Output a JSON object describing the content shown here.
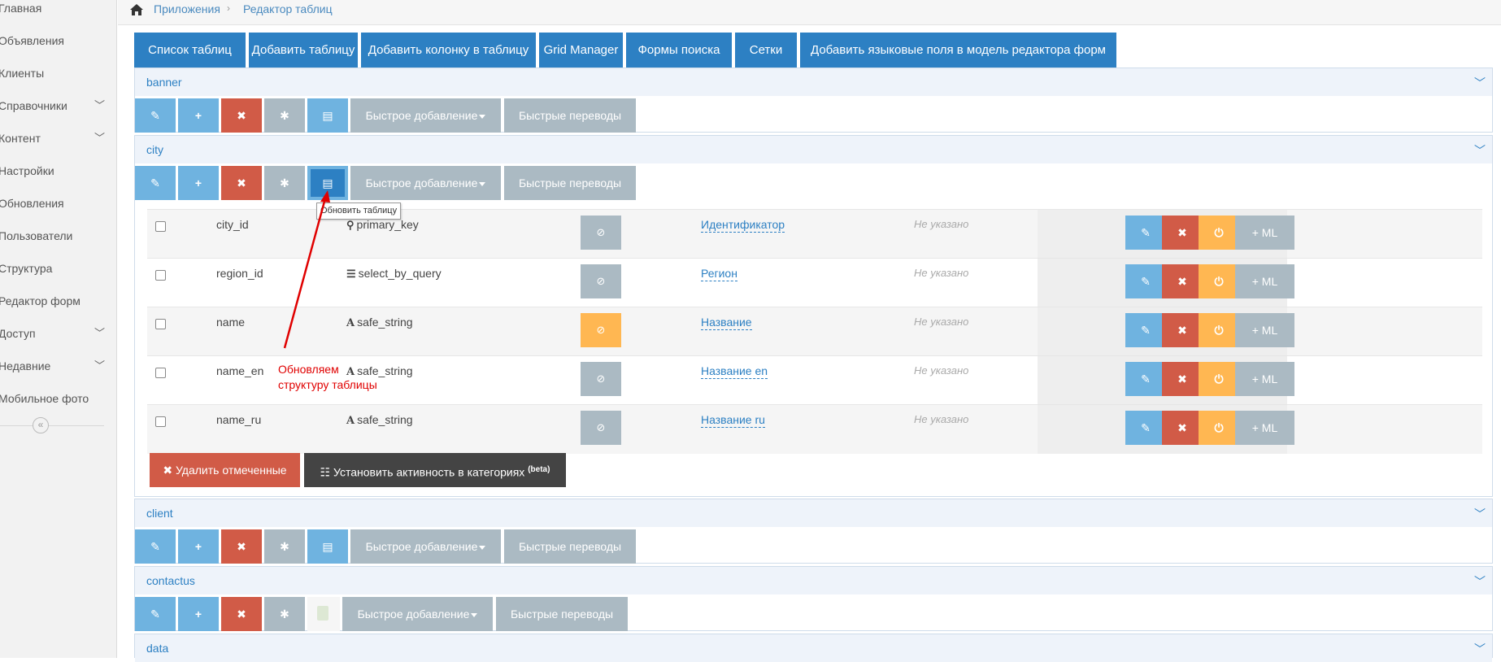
{
  "sidebar": {
    "items": [
      {
        "label": "Главная",
        "chevron": false
      },
      {
        "label": "Объявления",
        "chevron": false
      },
      {
        "label": "Клиенты",
        "chevron": false
      },
      {
        "label": "Справочники",
        "chevron": true
      },
      {
        "label": "Контент",
        "chevron": true
      },
      {
        "label": "Настройки",
        "chevron": false
      },
      {
        "label": "Обновления",
        "chevron": false
      },
      {
        "label": "Пользователи",
        "chevron": false
      },
      {
        "label": "Структура",
        "chevron": false
      },
      {
        "label": "Редактор форм",
        "chevron": false
      },
      {
        "label": "Доступ",
        "chevron": true
      },
      {
        "label": "Недавние",
        "chevron": true
      },
      {
        "label": "Мобильное фото",
        "chevron": false
      }
    ],
    "collapse_icon": "«"
  },
  "breadcrumb": {
    "home_icon": "⌂",
    "items": [
      "Приложения",
      "Редактор таблиц"
    ],
    "separator": "›"
  },
  "tabs": [
    "Список таблиц",
    "Добавить таблицу",
    "Добавить колонку в таблицу",
    "Grid Manager",
    "Формы поиска",
    "Сетки",
    "Добавить языковые поля в модель редактора форм"
  ],
  "toolbar": {
    "edit_icon": "✎",
    "add_icon": "+",
    "delete_icon": "✖",
    "asterisk_icon": "✱",
    "update_icon": "▤",
    "quick_add_label": "Быстрое добавление",
    "quick_translate_label": "Быстрые переводы"
  },
  "panels": [
    {
      "title": "banner"
    },
    {
      "title": "city"
    },
    {
      "title": "client"
    },
    {
      "title": "contactus"
    },
    {
      "title": "data"
    }
  ],
  "city_table": {
    "rows": [
      {
        "name": "city_id",
        "type_icon": "⚲",
        "type": "primary_key",
        "active": false,
        "title": "Идентификатор",
        "description": "Не указано"
      },
      {
        "name": "region_id",
        "type_icon": "☰",
        "type": "select_by_query",
        "active": false,
        "title": "Регион",
        "description": "Не указано"
      },
      {
        "name": "name",
        "type_icon": "A",
        "type": "safe_string",
        "active": true,
        "title": "Название",
        "description": "Не указано"
      },
      {
        "name": "name_en",
        "type_icon": "A",
        "type": "safe_string",
        "active": false,
        "title": "Название en",
        "description": "Не указано"
      },
      {
        "name": "name_ru",
        "type_icon": "A",
        "type": "safe_string",
        "active": false,
        "title": "Название ru",
        "description": "Не указано"
      }
    ],
    "row_actions": {
      "edit_icon": "✎",
      "delete_icon": "✖",
      "power_icon": "⏻",
      "ml_label": "+ ML",
      "check_icon": "⊘"
    },
    "delete_selected_label": "✖ Удалить отмеченные",
    "set_activity_label": "Установить активность в категориях",
    "set_activity_icon": "☷",
    "beta_label": "(beta)"
  },
  "tooltip": "Обновить таблицу",
  "annotation": {
    "line1": "Обновляем",
    "line2": "структуру таблицы",
    "color": "#e00000"
  },
  "colors": {
    "primary": "#2d80c3",
    "light_blue": "#6fb3e0",
    "danger": "#d15b47",
    "grey": "#abbac3",
    "warning": "#ffb752"
  }
}
